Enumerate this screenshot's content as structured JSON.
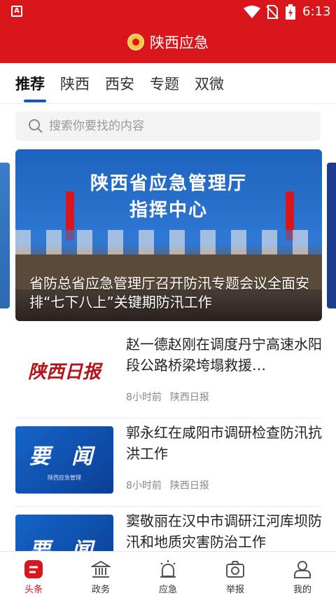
{
  "status": {
    "time": "6:13"
  },
  "header": {
    "title": "陕西应急"
  },
  "tabs": [
    {
      "label": "推荐",
      "active": true
    },
    {
      "label": "陕西"
    },
    {
      "label": "西安"
    },
    {
      "label": "专题"
    },
    {
      "label": "双微"
    }
  ],
  "search": {
    "placeholder": "搜索你要找的内容"
  },
  "banner": {
    "backdrop_line1": "陕西省应急管理厅",
    "backdrop_line2": "指挥中心",
    "caption": "省防总省应急管理厅召开防汛专题会议全面安排“七下八上”关键期防汛工作"
  },
  "news": [
    {
      "title": "赵一德赵刚在调度丹宁高速水阳段公路桥梁垮塌救援…",
      "time": "8小时前",
      "source": "陕西日报",
      "thumb_text": "陕西日报"
    },
    {
      "title": "郭永红在咸阳市调研检查防汛抗洪工作",
      "time": "8小时前",
      "source": "陕西日报",
      "thumb_text": "要 闻",
      "thumb_sub": "陕西应急管理"
    },
    {
      "title": "窦敬丽在汉中市调研江河库坝防汛和地质灾害防治工作",
      "thumb_text": "要 闻"
    }
  ],
  "bottomnav": [
    {
      "label": "头条",
      "icon": "headline-icon",
      "active": true
    },
    {
      "label": "政务",
      "icon": "government-building-icon"
    },
    {
      "label": "应急",
      "icon": "alarm-light-icon"
    },
    {
      "label": "举报",
      "icon": "camera-icon"
    },
    {
      "label": "我的",
      "icon": "user-icon"
    }
  ],
  "colors": {
    "brand_red": "#d9161c",
    "tab_indicator": "#1b56b5"
  }
}
